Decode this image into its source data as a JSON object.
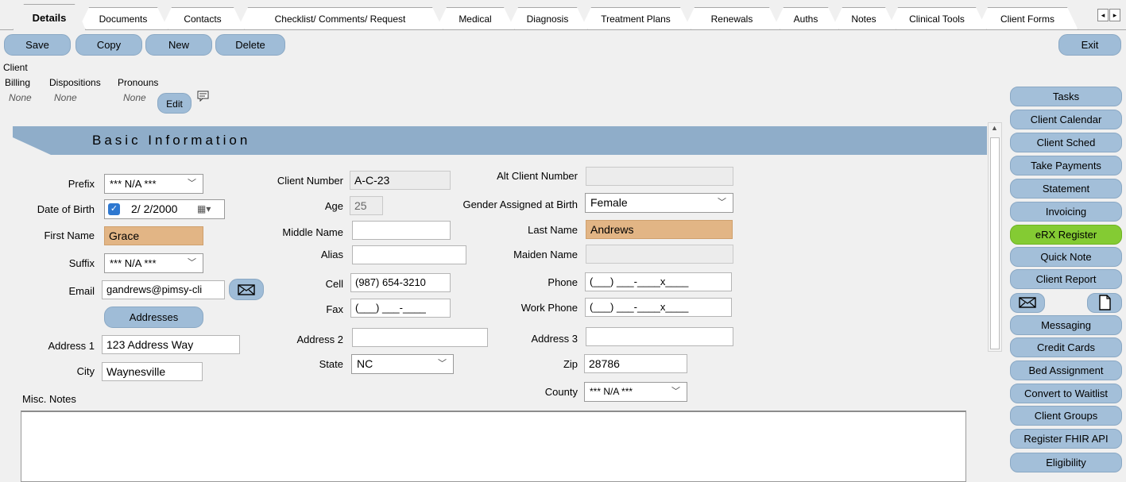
{
  "tabs": [
    {
      "label": "Details",
      "active": true
    },
    {
      "label": "Documents"
    },
    {
      "label": "Contacts"
    },
    {
      "label": "Checklist/ Comments/ Request"
    },
    {
      "label": "Medical"
    },
    {
      "label": "Diagnosis"
    },
    {
      "label": "Treatment Plans"
    },
    {
      "label": "Renewals"
    },
    {
      "label": "Auths"
    },
    {
      "label": "Notes"
    },
    {
      "label": "Clinical Tools"
    },
    {
      "label": "Client Forms"
    }
  ],
  "toolbar": {
    "save": "Save",
    "copy": "Copy",
    "new": "New",
    "delete": "Delete",
    "exit": "Exit"
  },
  "client_header": {
    "title": "Client",
    "billing_label": "Billing",
    "billing_value": "None",
    "dispositions_label": "Dispositions",
    "dispositions_value": "None",
    "pronouns_label": "Pronouns",
    "pronouns_value": "None",
    "edit": "Edit"
  },
  "section_title": "Basic Information",
  "form": {
    "prefix_label": "Prefix",
    "prefix_value": "*** N/A ***",
    "dob_label": "Date of Birth",
    "dob_value": "2/ 2/2000",
    "first_name_label": "First Name",
    "first_name_value": "Grace",
    "suffix_label": "Suffix",
    "suffix_value": "*** N/A ***",
    "email_label": "Email",
    "email_value": "gandrews@pimsy-cli",
    "addresses_button": "Addresses",
    "address1_label": "Address 1",
    "address1_value": "123 Address Way",
    "city_label": "City",
    "city_value": "Waynesville",
    "client_number_label": "Client Number",
    "client_number_value": "A-C-23",
    "age_label": "Age",
    "age_value": "25",
    "middle_name_label": "Middle Name",
    "middle_name_value": "",
    "alias_label": "Alias",
    "alias_value": "",
    "cell_label": "Cell",
    "cell_value": "(987) 654-3210",
    "fax_label": "Fax",
    "fax_value": "(___) ___-____",
    "address2_label": "Address 2",
    "address2_value": "",
    "state_label": "State",
    "state_value": "NC",
    "alt_client_number_label": "Alt Client Number",
    "alt_client_number_value": "",
    "gender_label": "Gender Assigned at Birth",
    "gender_value": "Female",
    "last_name_label": "Last Name",
    "last_name_value": "Andrews",
    "maiden_name_label": "Maiden Name",
    "maiden_name_value": "",
    "phone_label": "Phone",
    "phone_value": "(___) ___-____x____",
    "work_phone_label": "Work Phone",
    "work_phone_value": "(___) ___-____x____",
    "address3_label": "Address 3",
    "address3_value": "",
    "zip_label": "Zip",
    "zip_value": "28786",
    "county_label": "County",
    "county_value": "*** N/A ***",
    "misc_notes_label": "Misc. Notes",
    "misc_notes_value": ""
  },
  "sidebar": {
    "buttons": [
      "Tasks",
      "Client Calendar",
      "Client Sched",
      "Take Payments",
      "Statement",
      "Invoicing",
      "eRX Register",
      "Quick Note",
      "Client Report"
    ],
    "buttons2": [
      "Messaging",
      "Credit Cards",
      "Bed Assignment",
      "Convert to Waitlist",
      "Client Groups",
      "Register FHIR API",
      "Eligibility"
    ]
  },
  "colors": {
    "accent": "#9fbcd7",
    "banner": "#8fadc9",
    "highlight": "#e2b585",
    "green": "#84cb33"
  }
}
